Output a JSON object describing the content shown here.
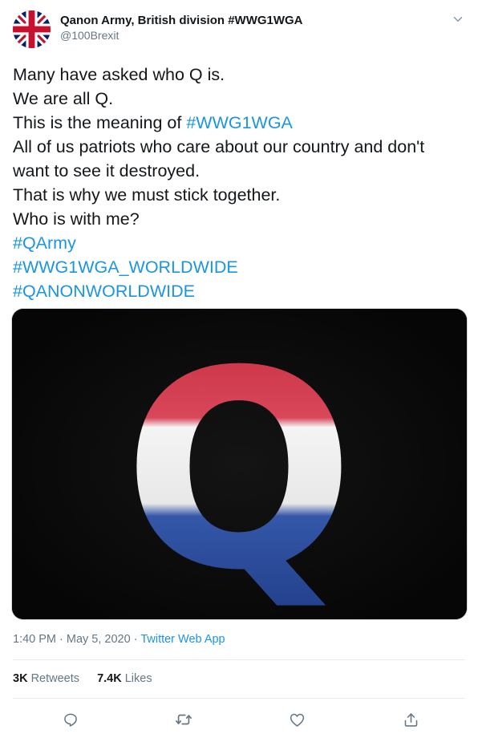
{
  "tweet": {
    "display_name": "Qanon Army, British division #WWG1WGA",
    "handle": "@100Brexit",
    "lines": [
      [
        {
          "t": "Many have asked who Q is."
        }
      ],
      [
        {
          "t": "We are all Q."
        }
      ],
      [
        {
          "t": "This is the meaning of "
        },
        {
          "t": "#WWG1WGA",
          "tag": true
        }
      ],
      [
        {
          "t": "All of us patriots who care about our country and don't"
        }
      ],
      [
        {
          "t": "want to see it destroyed."
        }
      ],
      [
        {
          "t": "That is why we must stick together."
        }
      ],
      [
        {
          "t": "Who is with me?"
        }
      ],
      [
        {
          "t": "#QArmy",
          "tag": true
        }
      ],
      [
        {
          "t": "#WWG1WGA_WORLDWIDE",
          "tag": true
        }
      ],
      [
        {
          "t": "#QANONWORLDWIDE",
          "tag": true
        }
      ]
    ],
    "image_letter": "Q",
    "timestamp": "1:40 PM · May 5, 2020 · ",
    "source": "Twitter Web App",
    "retweets_count": "3K",
    "retweets_label": "Retweets",
    "likes_count": "7.4K",
    "likes_label": "Likes"
  },
  "icons": {
    "avatar": "union-jack-flag",
    "menu": "chevron-down-icon",
    "reply": "reply-icon",
    "retweet": "retweet-icon",
    "like": "heart-icon",
    "share": "share-icon"
  },
  "colors": {
    "link": "#1b95e0",
    "secondary_text": "#657786",
    "primary_text": "#14171a",
    "icon": "#657786"
  }
}
